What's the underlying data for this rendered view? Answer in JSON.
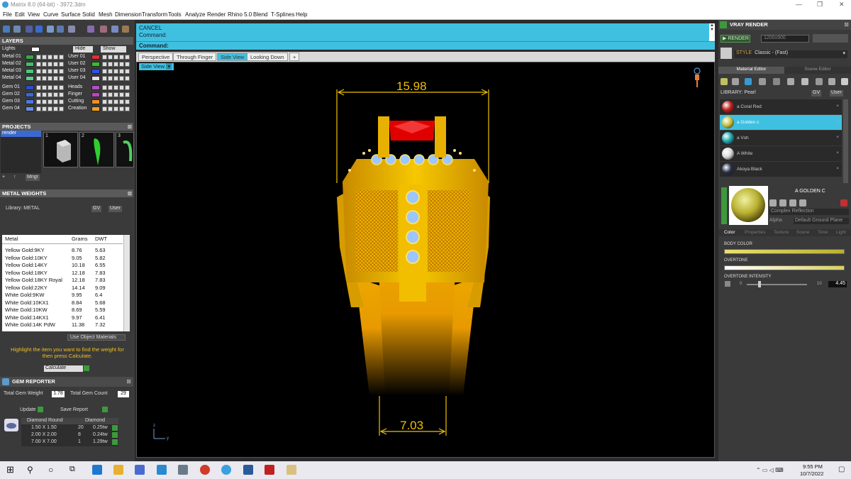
{
  "window": {
    "title": "Matrix 8.0 (64-bit) - 3972.3dm"
  },
  "menu": [
    "File",
    "Edit",
    "View",
    "Curve",
    "Surface",
    "Solid",
    "Mesh",
    "Dimension",
    "Transform",
    "Tools",
    "Analyze",
    "Render",
    "Rhino 5.0",
    "Blend",
    "T-Splines",
    "Help"
  ],
  "layers": {
    "header": "LAYERS",
    "lights": "Lights",
    "hide": "Hide",
    "show": "Show",
    "left": [
      {
        "label": "Metal 01",
        "color": "#39a64a"
      },
      {
        "label": "Metal 02",
        "color": "#3fbf6a"
      },
      {
        "label": "Metal 03",
        "color": "#47c97e"
      },
      {
        "label": "Metal 04",
        "color": "#5bd090"
      },
      {
        "label": "Gem 01",
        "color": "#2a50c8"
      },
      {
        "label": "Gem 02",
        "color": "#3a66d8"
      },
      {
        "label": "Gem 03",
        "color": "#4a7ae0"
      },
      {
        "label": "Gem 04",
        "color": "#6a8ee8"
      }
    ],
    "right": [
      {
        "label": "User 01",
        "color": "#e03030"
      },
      {
        "label": "User 02",
        "color": "#30c030"
      },
      {
        "label": "User 03",
        "color": "#3050e0"
      },
      {
        "label": "User 04",
        "color": "#e0e0e0"
      },
      {
        "label": "Heads",
        "color": "#b050c0"
      },
      {
        "label": "Finger",
        "color": "#c040c0"
      },
      {
        "label": "Cutting",
        "color": "#f09020"
      },
      {
        "label": "Creation",
        "color": "#f0a020"
      }
    ]
  },
  "projects": {
    "header": "PROJECTS",
    "items": [
      "render"
    ],
    "thumbs": [
      "1",
      "2",
      "3"
    ],
    "mngr": "Mngr"
  },
  "metal_weights": {
    "header": "METAL WEIGHTS",
    "library_label": "Library: METAL",
    "gv": "GV",
    "user": "User",
    "columns": [
      "Metal",
      "Grams",
      "DWT"
    ],
    "rows": [
      [
        "Yellow Gold:9KY",
        "8.76",
        "5.63"
      ],
      [
        "Yellow Gold:10KY",
        "9.05",
        "5.82"
      ],
      [
        "Yellow Gold:14KY",
        "10.18",
        "6.55"
      ],
      [
        "Yellow Gold:18KY",
        "12.18",
        "7.83"
      ],
      [
        "Yellow Gold:18KY Royal",
        "12.18",
        "7.83"
      ],
      [
        "Yellow Gold:22KY",
        "14.14",
        "9.09"
      ],
      [
        "White Gold:9KW",
        "9.95",
        "6.4"
      ],
      [
        "White Gold:10KX1",
        "8.84",
        "5.68"
      ],
      [
        "White Gold:10KW",
        "8.69",
        "5.59"
      ],
      [
        "White Gold:14KX1",
        "9.97",
        "6.41"
      ],
      [
        "White Gold:14K PdW",
        "11.38",
        "7.32"
      ]
    ],
    "use_object_materials": "Use Object Materials",
    "hint": "Highlight the item you want to find the weight for then press Calculate.",
    "calculate": "Calculate"
  },
  "gem_reporter": {
    "header": "GEM REPORTER",
    "total_weight_label": "Total Gem Weight",
    "total_weight": "1.78",
    "total_count_label": "Total Gem Count",
    "total_count": "29",
    "update": "Update",
    "save_report": "Save Report",
    "columns": [
      "Diamond Round",
      "Diamond"
    ],
    "rows": [
      [
        "1.50 X 1.50",
        "20",
        "0.25tw"
      ],
      [
        "2.00 X 2.00",
        "8",
        "0.24tw"
      ],
      [
        "7.00 X 7.00",
        "1",
        "1.29tw"
      ]
    ]
  },
  "command": {
    "line1": "CANCEL",
    "line2": "Command:",
    "prompt": "Command:"
  },
  "view_tabs": [
    "Perspective",
    "Through Finger",
    "Side View",
    "Looking Down"
  ],
  "active_tab": "Side View",
  "viewport": {
    "label": "Side View",
    "dim_top": "15.98",
    "dim_bottom": "7.03",
    "axis_z": "z",
    "axis_y": "y"
  },
  "vray": {
    "header": "VRAY RENDER",
    "render": "RENDER",
    "resolution": "1200x900",
    "style_label": "STYLE",
    "style_value": "Classic - (Fast)",
    "tabs": [
      "Material Editor",
      "Scene Editor"
    ],
    "library_label": "LIBRARY: Pearl",
    "materials": [
      {
        "name": "a Coral Red",
        "color": "#c0201a"
      },
      {
        "name": "a Golden c",
        "color": "#c8c040"
      },
      {
        "name": "a Vsh",
        "color": "#20a8b0"
      },
      {
        "name": "A White",
        "color": "#dcdcdc"
      },
      {
        "name": "Akoya Black",
        "color": "#2a3048"
      }
    ],
    "selected_material": "A GOLDEN C",
    "complex_reflection": "Complex Reflection",
    "alpha_label": "Alpha",
    "default_ground": "Default Ground Plane",
    "prop_tabs": [
      "Color",
      "Properties",
      "Texture",
      "Scene",
      "Tone",
      "Light"
    ],
    "body_color": "BODY COLOR",
    "overtone": "OVERTONE",
    "overtone_intensity": "OVERTONE INTENSITY",
    "slider_min": "0",
    "slider_max": "10",
    "intensity_value": "4.45"
  },
  "taskbar": {
    "time": "9:55 PM",
    "date": "10/7/2022"
  }
}
